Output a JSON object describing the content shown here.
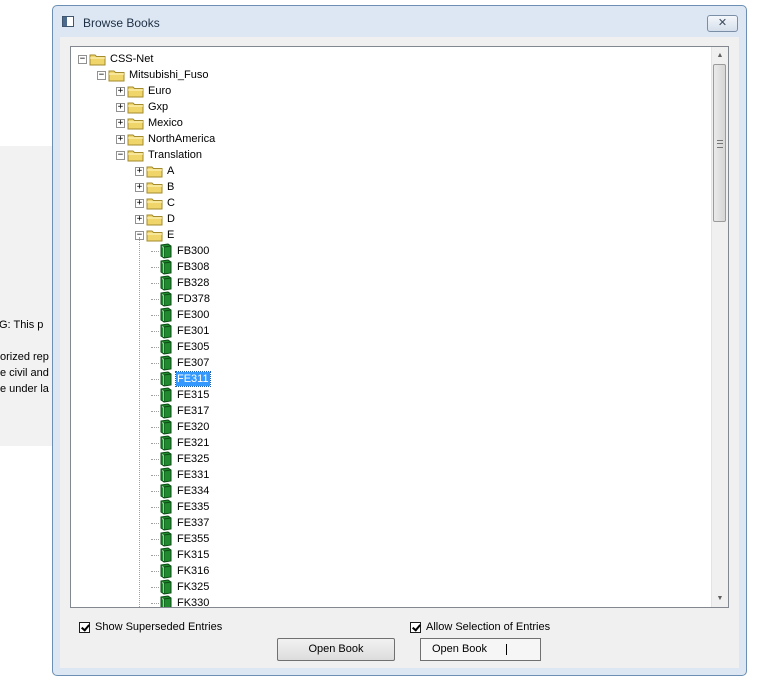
{
  "background": {
    "lines": [
      "G: This p",
      "orized rep",
      "e civil and",
      "e under la"
    ]
  },
  "dialog": {
    "title": "Browse Books",
    "close_glyph": "✕"
  },
  "tree": {
    "rows": [
      {
        "label": "CSS-Net",
        "type": "folder",
        "level": 0,
        "expander": "−"
      },
      {
        "label": "Mitsubishi_Fuso",
        "type": "folder",
        "level": 1,
        "expander": "−"
      },
      {
        "label": "Euro",
        "type": "folder",
        "level": 2,
        "expander": "+"
      },
      {
        "label": "Gxp",
        "type": "folder",
        "level": 2,
        "expander": "+"
      },
      {
        "label": "Mexico",
        "type": "folder",
        "level": 2,
        "expander": "+"
      },
      {
        "label": "NorthAmerica",
        "type": "folder",
        "level": 2,
        "expander": "+"
      },
      {
        "label": "Translation",
        "type": "folder",
        "level": 2,
        "expander": "−"
      },
      {
        "label": "A",
        "type": "folder",
        "level": 3,
        "expander": "+"
      },
      {
        "label": "B",
        "type": "folder",
        "level": 3,
        "expander": "+"
      },
      {
        "label": "C",
        "type": "folder",
        "level": 3,
        "expander": "+"
      },
      {
        "label": "D",
        "type": "folder",
        "level": 3,
        "expander": "+"
      },
      {
        "label": "E",
        "type": "folder",
        "level": 3,
        "expander": "−"
      },
      {
        "label": "FB300",
        "type": "book",
        "level": 4
      },
      {
        "label": "FB308",
        "type": "book",
        "level": 4
      },
      {
        "label": "FB328",
        "type": "book",
        "level": 4
      },
      {
        "label": "FD378",
        "type": "book",
        "level": 4
      },
      {
        "label": "FE300",
        "type": "book",
        "level": 4
      },
      {
        "label": "FE301",
        "type": "book",
        "level": 4
      },
      {
        "label": "FE305",
        "type": "book",
        "level": 4
      },
      {
        "label": "FE307",
        "type": "book",
        "level": 4
      },
      {
        "label": "FE311",
        "type": "book",
        "level": 4,
        "selected": true
      },
      {
        "label": "FE315",
        "type": "book",
        "level": 4
      },
      {
        "label": "FE317",
        "type": "book",
        "level": 4
      },
      {
        "label": "FE320",
        "type": "book",
        "level": 4
      },
      {
        "label": "FE321",
        "type": "book",
        "level": 4
      },
      {
        "label": "FE325",
        "type": "book",
        "level": 4
      },
      {
        "label": "FE331",
        "type": "book",
        "level": 4
      },
      {
        "label": "FE334",
        "type": "book",
        "level": 4
      },
      {
        "label": "FE335",
        "type": "book",
        "level": 4
      },
      {
        "label": "FE337",
        "type": "book",
        "level": 4
      },
      {
        "label": "FE355",
        "type": "book",
        "level": 4
      },
      {
        "label": "FK315",
        "type": "book",
        "level": 4
      },
      {
        "label": "FK316",
        "type": "book",
        "level": 4
      },
      {
        "label": "FK325",
        "type": "book",
        "level": 4
      },
      {
        "label": "FK330",
        "type": "book",
        "level": 4
      }
    ]
  },
  "options": {
    "show_superseded_label": "Show Superseded Entries",
    "show_superseded_checked": true,
    "allow_selection_label": "Allow Selection of Entries",
    "allow_selection_checked": true
  },
  "buttons": {
    "open_book_label": "Open Book",
    "open_book_2_label": "Open Book"
  },
  "colors": {
    "selection": "#3399ff",
    "folder": "#f0d56a",
    "book": "#1f8a2e"
  }
}
